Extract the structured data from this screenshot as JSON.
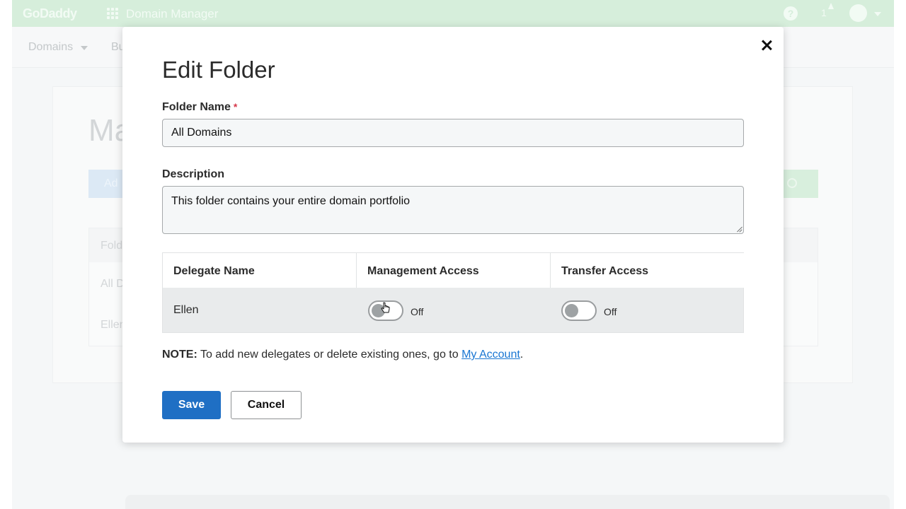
{
  "background": {
    "logo": "GoDaddy",
    "app_name": "Domain Manager",
    "notification_count": "1",
    "subnav": {
      "domains": "Domains",
      "second": "Bu"
    },
    "page_title": "Ma",
    "add_button": "Ad",
    "table": {
      "header": "Fold",
      "row1": "All D",
      "row2": "Ellen"
    }
  },
  "modal": {
    "title": "Edit Folder",
    "folder_name": {
      "label": "Folder Name",
      "required_mark": "*",
      "value": "All Domains"
    },
    "description": {
      "label": "Description",
      "value": "This folder contains your entire domain portfolio"
    },
    "delegates": {
      "columns": [
        "Delegate Name",
        "Management Access",
        "Transfer Access"
      ],
      "rows": [
        {
          "name": "Ellen",
          "management_access": "Off",
          "transfer_access": "Off"
        }
      ]
    },
    "note": {
      "prefix": "NOTE:",
      "text": " To add new delegates or delete existing ones, go to ",
      "link": "My Account",
      "suffix": "."
    },
    "save_label": "Save",
    "cancel_label": "Cancel"
  },
  "colors": {
    "primary_button": "#1f6fc4",
    "link": "#1976d2",
    "required": "#d6384a",
    "topbar": "#d6eedb"
  },
  "icons": [
    "apps-grid-icon",
    "help-icon",
    "bell-icon",
    "user-avatar-icon",
    "caret-down-icon",
    "search-icon",
    "close-icon",
    "pointer-cursor-icon",
    "resize-grip-icon"
  ]
}
